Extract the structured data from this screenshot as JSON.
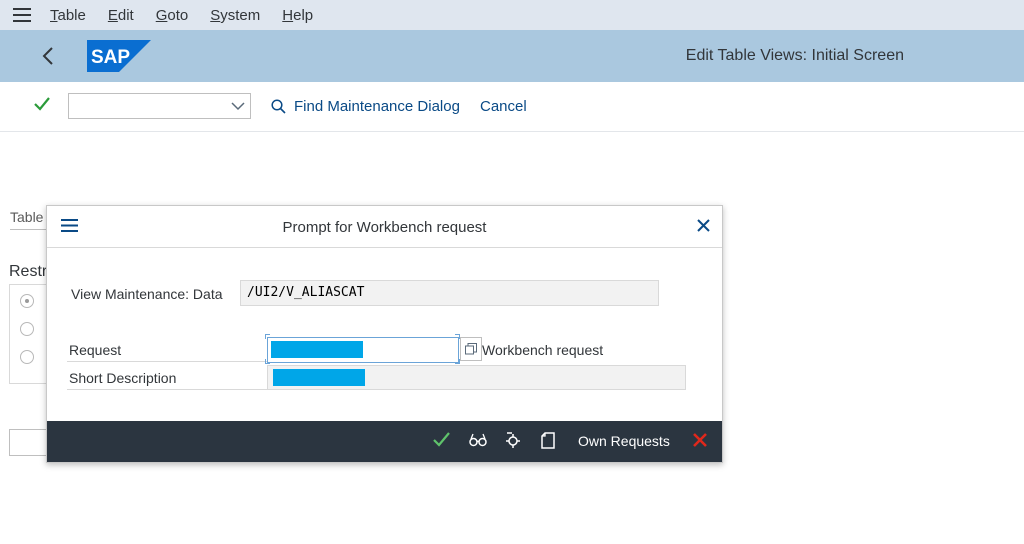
{
  "menu": {
    "items": [
      "Table",
      "Edit",
      "Goto",
      "System",
      "Help"
    ]
  },
  "titlebar": {
    "title": "Edit Table Views: Initial Screen",
    "logo_text": "SAP"
  },
  "toolbar": {
    "dropdown_value": "",
    "find_label": "Find Maintenance Dialog",
    "cancel_label": "Cancel"
  },
  "background": {
    "table_label": "Table",
    "restrict_label": "Restr"
  },
  "dialog": {
    "title": "Prompt for Workbench request",
    "view_maintenance_label": "View Maintenance: Data",
    "view_maintenance_value": "/UI2/V_ALIASCAT",
    "request_label": "Request",
    "request_type_label": "Workbench request",
    "short_description_label": "Short Description",
    "footer": {
      "own_requests_label": "Own Requests"
    }
  },
  "colors": {
    "menubar_bg": "#dfe6ef",
    "titlebar_bg": "#aac8df",
    "footer_bg": "#2b3540",
    "link_blue": "#0a4a86",
    "redaction": "#00a6e8",
    "confirm_green": "#2b9b3a",
    "cancel_red": "#e0281c"
  }
}
